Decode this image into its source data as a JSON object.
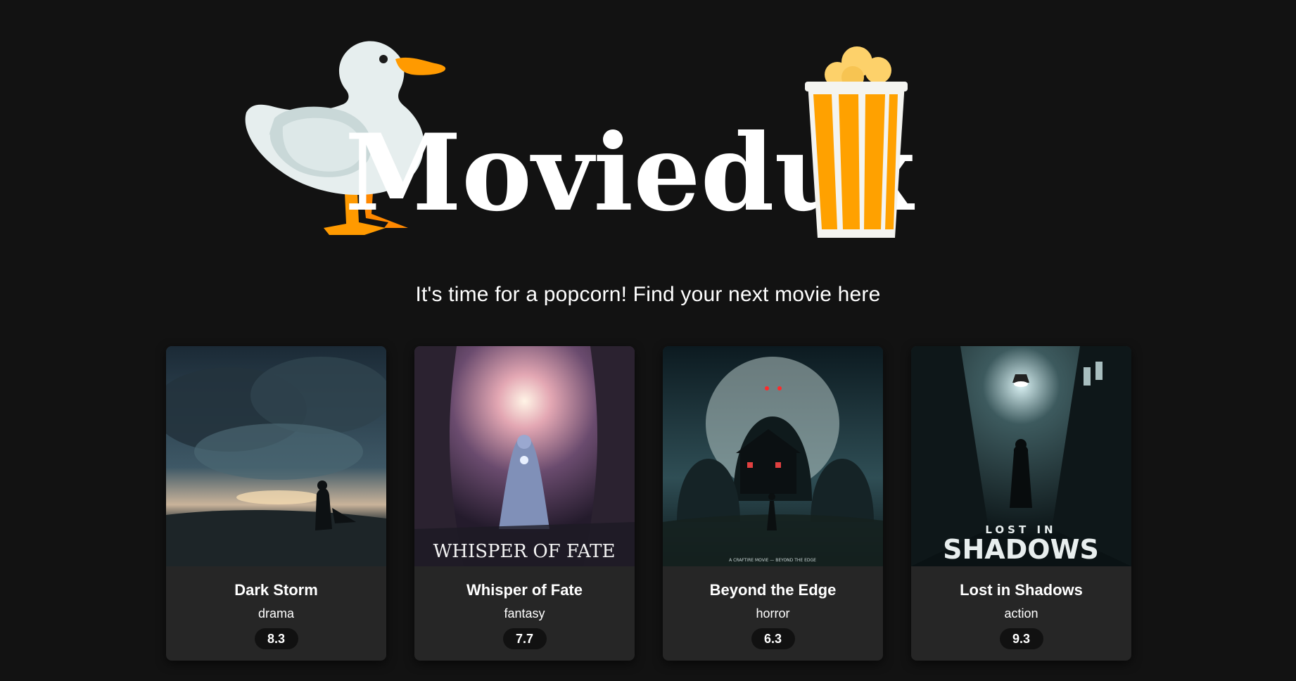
{
  "brand": {
    "name": "Moviedux",
    "duck_icon": "duck-icon",
    "popcorn_icon": "popcorn-icon",
    "colors": {
      "duck_body": "#e6eeee",
      "duck_beak": "#ff9a00",
      "popcorn_stripe": "#ffa100",
      "popcorn_kernel": "#fdd16a"
    }
  },
  "tagline": "It's time for a popcorn! Find your next movie here",
  "movies": [
    {
      "title": "Dark Storm",
      "genre": "drama",
      "rating": "8.3",
      "poster_text": ""
    },
    {
      "title": "Whisper of Fate",
      "genre": "fantasy",
      "rating": "7.7",
      "poster_text": "WHISPER OF FATE"
    },
    {
      "title": "Beyond the Edge",
      "genre": "horror",
      "rating": "6.3",
      "poster_text": "A CRAFTIRE MOVIE — BEYOND THE EDGE"
    },
    {
      "title": "Lost in Shadows",
      "genre": "action",
      "rating": "9.3",
      "poster_text_top": "LOST IN",
      "poster_text_bottom": "SHADOWS"
    }
  ]
}
